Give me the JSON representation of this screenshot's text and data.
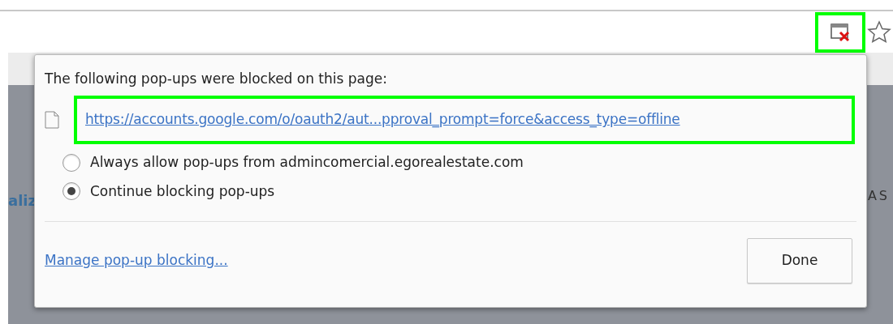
{
  "toolbar": {
    "popup_blocked_icon": {
      "highlighted": true
    }
  },
  "page_behind": {
    "left_text": "aliz",
    "right_text": "AS"
  },
  "popup": {
    "heading": "The following pop-ups were blocked on this page:",
    "blocked": [
      {
        "url": "https://accounts.google.com/o/oauth2/aut...pproval_prompt=force&access_type=offline",
        "highlighted": true
      }
    ],
    "options": [
      {
        "label": "Always allow pop-ups from admincomercial.egorealestate.com",
        "selected": false
      },
      {
        "label": "Continue blocking pop-ups",
        "selected": true
      }
    ],
    "manage_link": "Manage pop-up blocking...",
    "done_button": "Done"
  }
}
